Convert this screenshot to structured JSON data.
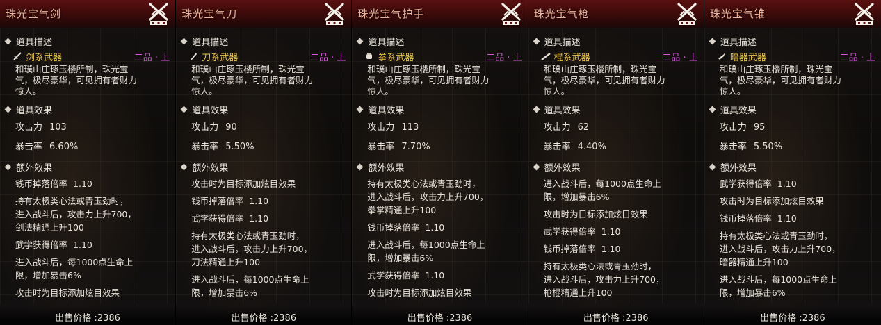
{
  "labels": {
    "desc_section": "道具描述",
    "effect_section": "道具效果",
    "extra_section": "额外效果",
    "atk_label": "攻击力",
    "crit_label": "暴击率",
    "price_label": "出售价格 :",
    "grade": "二品 · 上",
    "description": "和璞山庄琢玉楼所制，珠光宝\n气，极尽豪华，可见拥有者财力\n惊人。"
  },
  "colors": {
    "header": "#5a1010",
    "title": "#f2b39a",
    "type": "#e8c24a",
    "grade": "#d25ad8"
  },
  "cards": [
    {
      "title": "珠光宝气剑",
      "type_icon": "sword-icon",
      "type_name": "剑系武器",
      "atk": "103",
      "crit": "6.60%",
      "price": "2386",
      "extras": [
        {
          "text": "钱币掉落倍率",
          "value": "1.10"
        },
        {
          "text": "持有太极类心法或青玉劲时，\n进入战斗后，攻击力上升700，\n剑法精通上升100",
          "value": ""
        },
        {
          "text": "武学获得倍率",
          "value": "1.10"
        },
        {
          "text": "进入战斗后，每1000点生命上\n限，增加暴击6%",
          "value": ""
        },
        {
          "text": "攻击时为目标添加炫目效果",
          "value": ""
        }
      ]
    },
    {
      "title": "珠光宝气刀",
      "type_icon": "blade-icon",
      "type_name": "刀系武器",
      "atk": "90",
      "crit": "5.50%",
      "price": "2386",
      "extras": [
        {
          "text": "攻击时为目标添加炫目效果",
          "value": ""
        },
        {
          "text": "钱币掉落倍率",
          "value": "1.10"
        },
        {
          "text": "武学获得倍率",
          "value": "1.10"
        },
        {
          "text": "持有太极类心法或青玉劲时，\n进入战斗后，攻击力上升700，\n刀法精通上升100",
          "value": ""
        },
        {
          "text": "进入战斗后，每1000点生命上\n限，增加暴击6%",
          "value": ""
        }
      ]
    },
    {
      "title": "珠光宝气护手",
      "type_icon": "fist-icon",
      "type_name": "拳系武器",
      "atk": "113",
      "crit": "7.70%",
      "price": "2386",
      "extras": [
        {
          "text": "持有太极类心法或青玉劲时，\n进入战斗后，攻击力上升700，\n拳掌精通上升100",
          "value": ""
        },
        {
          "text": "钱币掉落倍率",
          "value": "1.10"
        },
        {
          "text": "进入战斗后，每1000点生命上\n限，增加暴击6%",
          "value": ""
        },
        {
          "text": "武学获得倍率",
          "value": "1.10"
        },
        {
          "text": "攻击时为目标添加炫目效果",
          "value": ""
        }
      ]
    },
    {
      "title": "珠光宝气枪",
      "type_icon": "staff-icon",
      "type_name": "棍系武器",
      "atk": "62",
      "crit": "4.40%",
      "price": "2386",
      "extras": [
        {
          "text": "进入战斗后，每1000点生命上\n限，增加暴击6%",
          "value": ""
        },
        {
          "text": "攻击时为目标添加炫目效果",
          "value": ""
        },
        {
          "text": "武学获得倍率",
          "value": "1.10"
        },
        {
          "text": "钱币掉落倍率",
          "value": "1.10"
        },
        {
          "text": "持有太极类心法或青玉劲时，\n进入战斗后，攻击力上升700，\n枪棍精通上升100",
          "value": ""
        }
      ]
    },
    {
      "title": "珠光宝气锥",
      "type_icon": "dart-icon",
      "type_name": "暗器武器",
      "atk": "95",
      "crit": "5.50%",
      "price": "2386",
      "extras": [
        {
          "text": "武学获得倍率",
          "value": "1.10"
        },
        {
          "text": "攻击时为目标添加炫目效果",
          "value": ""
        },
        {
          "text": "钱币掉落倍率",
          "value": "1.10"
        },
        {
          "text": "持有太极类心法或青玉劲时，\n进入战斗后，攻击力上升700，\n暗器精通上升100",
          "value": ""
        },
        {
          "text": "进入战斗后，每1000点生命上\n限，增加暴击6%",
          "value": ""
        }
      ]
    }
  ]
}
